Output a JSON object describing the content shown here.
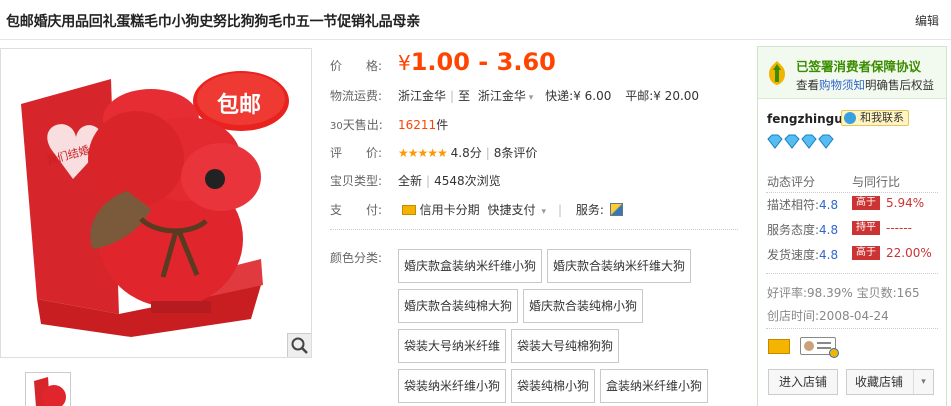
{
  "title": "包邮婚庆用品回礼蛋糕毛巾小狗史努比狗狗毛巾五一节促销礼品母亲",
  "edit_label": "编辑",
  "gallery": {
    "badge_text": "包邮",
    "card_text": "我们结婚"
  },
  "props": {
    "price": {
      "label": "价　　格:",
      "symbol": "¥",
      "value": "1.00 - 3.60"
    },
    "shipping": {
      "label": "物流运费:",
      "from": "浙江金华",
      "to_word": "至",
      "to": "浙江金华",
      "express": "快递:",
      "express_price": "¥ 6.00",
      "normal": "平邮:",
      "normal_price": "¥ 20.00"
    },
    "sales": {
      "label_prefix": "30",
      "label": "天售出:",
      "count": "16211",
      "unit": "件"
    },
    "rating": {
      "label": "评　　价:",
      "score": "4.8分",
      "reviews": "8条评价",
      "stars": "★★★★★"
    },
    "type": {
      "label": "宝贝类型:",
      "condition": "全新",
      "views": "4548次浏览"
    },
    "payment": {
      "label": "支　　付:",
      "credit": "信用卡分期",
      "quick": "快捷支付",
      "service": "服务:"
    }
  },
  "sku": {
    "label": "颜色分类:",
    "options": [
      "婚庆款盒装纳米纤维小狗",
      "婚庆款合装纳米纤维大狗",
      "婚庆款合装纯棉大狗",
      "婚庆款合装纯棉小狗",
      "袋装大号纳米纤维",
      "袋装大号纯棉狗狗",
      "袋装纳米纤维小狗",
      "袋装纯棉小狗",
      "盒装纳米纤维小狗"
    ]
  },
  "shop": {
    "guarantee_title": "已签署消费者保障协议",
    "guarantee_pre": "查看",
    "guarantee_link": "购物须知",
    "guarantee_post": "明确售后权益",
    "seller": "fengzhingu",
    "contact": "和我联系",
    "score_label": "动态评分",
    "compare_label": "与同行比",
    "scores": [
      {
        "label": "描述相符:",
        "value": "4.8",
        "badge": "高于",
        "pct": "5.94%"
      },
      {
        "label": "服务态度:",
        "value": "4.8",
        "badge": "持平",
        "pct": "------"
      },
      {
        "label": "发货速度:",
        "value": "4.8",
        "badge": "高于",
        "pct": "22.00%"
      }
    ],
    "good_rate": "好评率:98.39%",
    "deposit": "宝贝数:165",
    "created": "创店时间:2008-04-24",
    "enter": "进入店铺",
    "favorite": "收藏店铺",
    "colors": {
      "accent": "#ff4400",
      "brand_green": "#3a8d00",
      "link": "#3366cc",
      "badge": "#cc3333"
    }
  }
}
